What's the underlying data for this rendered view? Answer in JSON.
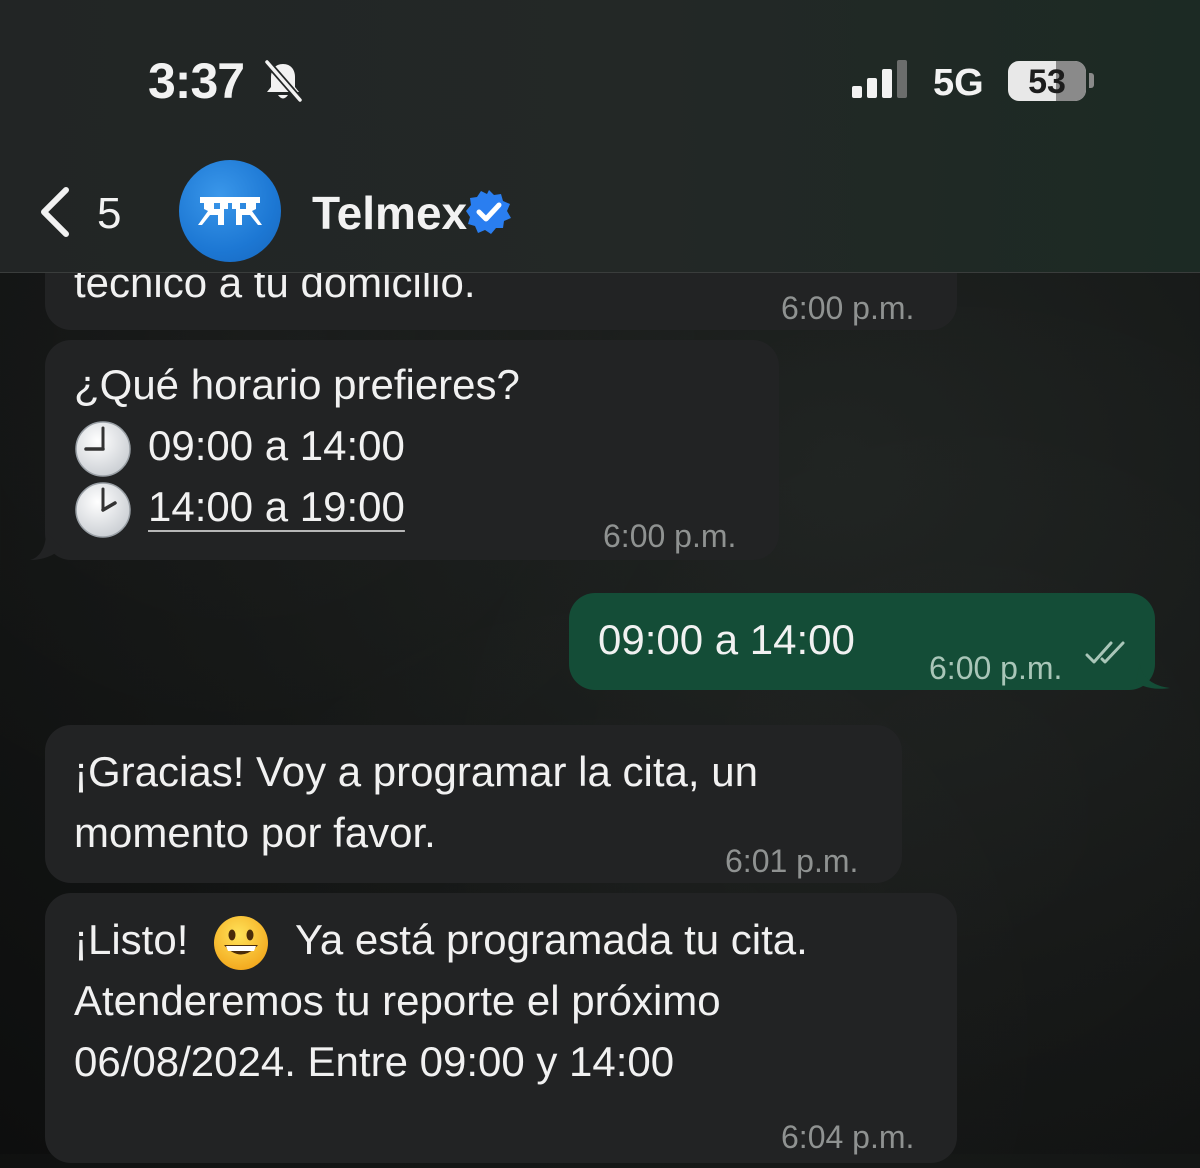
{
  "status_bar": {
    "time": "3:37",
    "network": "5G",
    "battery": "53",
    "icons": [
      "bell-slash-icon",
      "signal-icon",
      "battery-icon"
    ]
  },
  "header": {
    "back_count": "5",
    "contact_name": "Telmex",
    "verified": true,
    "icons": [
      "chevron-left-icon",
      "avatar",
      "verified-badge-icon"
    ]
  },
  "colors": {
    "incoming_bubble": "#222324",
    "outgoing_bubble": "#144d37",
    "avatar_blue": "#1d78d4",
    "verified_blue": "#2a7ef0"
  },
  "messages": [
    {
      "direction": "in",
      "lines": [
        "técnico a tu domicilio."
      ],
      "time": "6:00 p.m."
    },
    {
      "direction": "in",
      "lines": [
        "¿Qué horario prefieres?",
        "09:00 a 14:00",
        "14:00 a 19:00"
      ],
      "line_icons": [
        "",
        "clock-nine-icon",
        "clock-two-icon"
      ],
      "time": "6:00 p.m."
    },
    {
      "direction": "out",
      "lines": [
        "09:00 a 14:00"
      ],
      "time": "6:00 p.m.",
      "receipt": "double-check-icon"
    },
    {
      "direction": "in",
      "lines": [
        "¡Gracias! Voy a programar la cita, un",
        "momento por favor."
      ],
      "time": "6:01 p.m."
    },
    {
      "direction": "in",
      "lines": [
        "¡Listo!",
        "Ya está programada tu cita.",
        "Atenderemos tu reporte el próximo",
        "06/08/2024. Entre 09:00 y 14:00"
      ],
      "line_icons": [
        "grinning-face-icon"
      ],
      "time": "6:04 p.m."
    }
  ]
}
